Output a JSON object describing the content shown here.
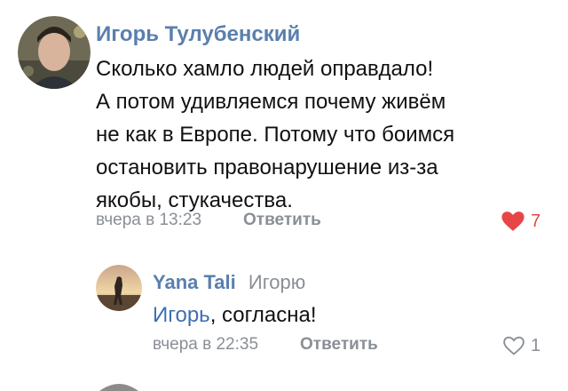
{
  "comments": [
    {
      "author": "Игорь Тулубенский",
      "text_lines": [
        "Сколько хамло людей оправдало!",
        "А потом удивляемся почему живём",
        "не как в Европе. Потому что боимся",
        "остановить правонарушение из-за",
        "якобы, стукачества."
      ],
      "time": "вчера в 13:23",
      "reply_label": "Ответить",
      "likes": "7",
      "liked": true,
      "avatar_icon": "user-photo"
    }
  ],
  "replies": [
    {
      "author": "Yana Tali",
      "reply_to": "Игорю",
      "mention": "Игорь",
      "text_rest": ", согласна!",
      "time": "вчера в 22:35",
      "reply_label": "Ответить",
      "likes": "1",
      "liked": false,
      "avatar_icon": "user-photo"
    }
  ],
  "colors": {
    "author": "#5a7fae",
    "mention": "#3f6fb3",
    "meta": "#8a8f96",
    "heart_liked": "#e64646"
  }
}
